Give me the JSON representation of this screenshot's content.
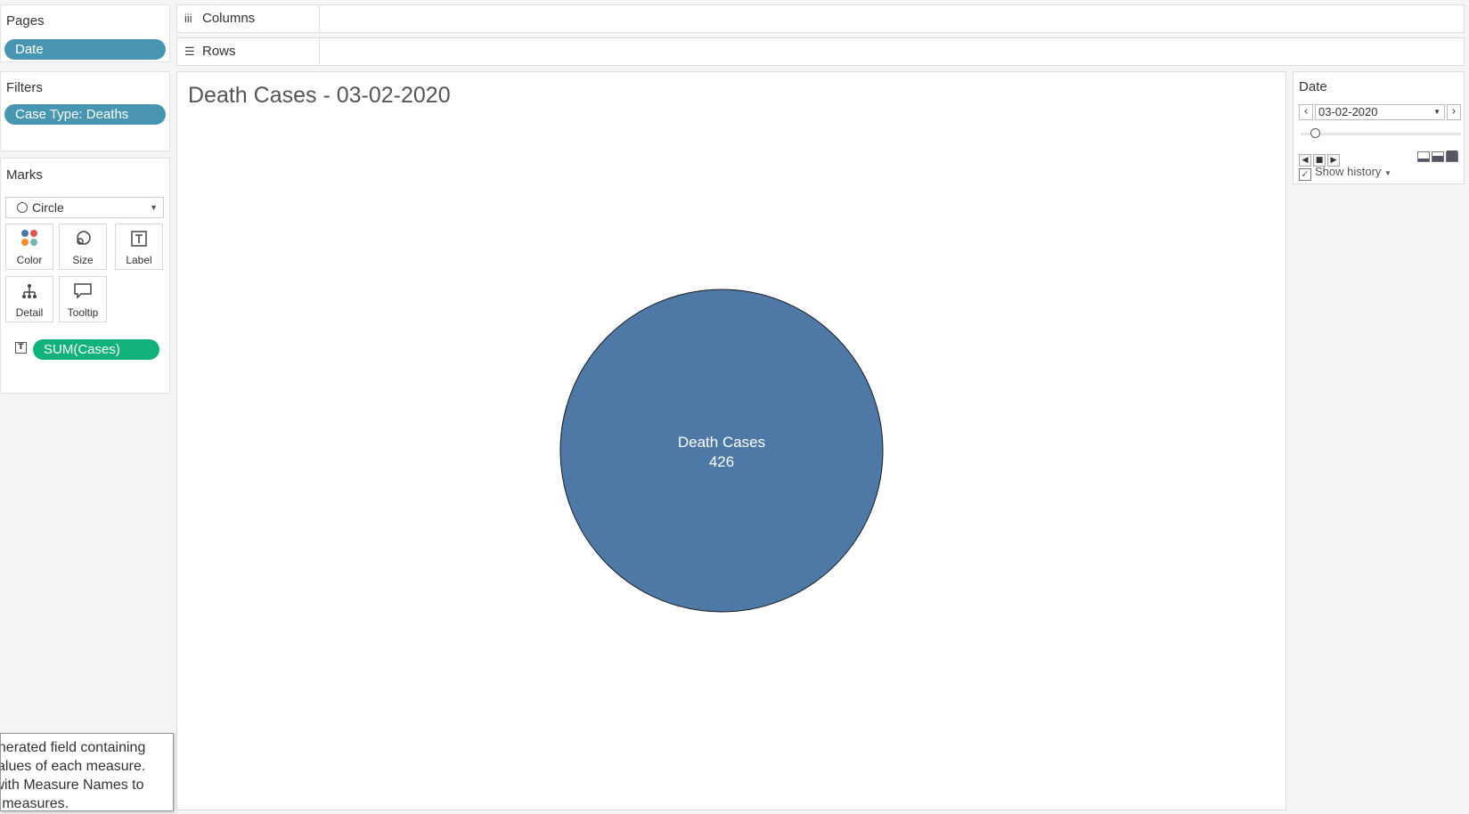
{
  "cards": {
    "pages": {
      "title": "Pages",
      "pill": "Date"
    },
    "filters": {
      "title": "Filters",
      "pill": "Case Type: Deaths"
    },
    "marks": {
      "title": "Marks",
      "mark_type": "Circle",
      "buttons": {
        "color": "Color",
        "size": "Size",
        "label": "Label",
        "detail": "Detail",
        "tooltip": "Tooltip"
      },
      "field_pill": "SUM(Cases)"
    }
  },
  "shelves": {
    "columns": "Columns",
    "rows": "Rows"
  },
  "viz": {
    "title": "Death Cases - 03-02-2020"
  },
  "chart_data": {
    "type": "scatter",
    "mark": "circle",
    "points": [
      {
        "label": "Death Cases",
        "value": 426
      }
    ],
    "title": "Death Cases - 03-02-2020",
    "color": "#4e79a7"
  },
  "page_control": {
    "title": "Date",
    "value": "03-02-2020",
    "show_history": "Show history",
    "show_history_checked": true
  },
  "tooltip_lines": [
    "enerated field containing",
    "values of each measure.",
    " with Measure Names to",
    "d measures."
  ],
  "colors": {
    "accent_pill": "#4996b2",
    "measure_pill": "#11b17c",
    "mark": "#4e79a7"
  },
  "icons": [
    "columns-icon",
    "rows-icon",
    "circle-icon",
    "color-icon",
    "size-icon",
    "label-icon",
    "detail-icon",
    "tooltip-icon",
    "play-icon"
  ]
}
